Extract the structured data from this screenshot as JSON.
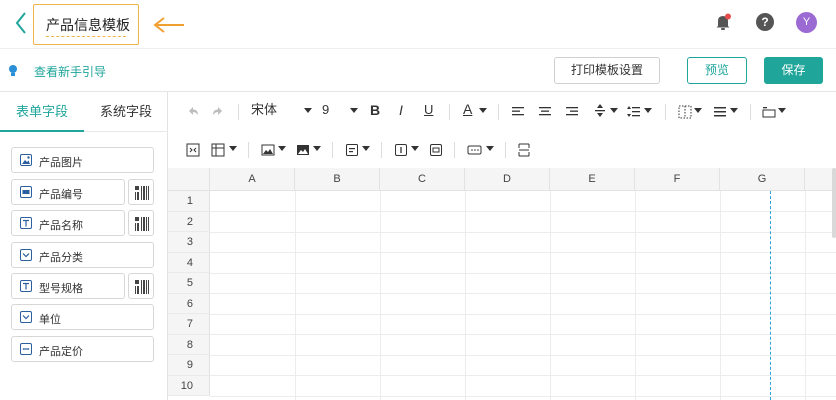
{
  "header": {
    "template_title": "产品信息模板",
    "avatar_letter": "Y",
    "help_symbol": "?",
    "icons": [
      "chevron-left-icon",
      "arrow-left-icon",
      "bell-icon",
      "help-icon"
    ],
    "colors": {
      "accent": "#1fa59a",
      "highlight": "#f0b44c",
      "notification_dot": "#e84d4d",
      "avatar": "#9b6ad2"
    }
  },
  "actionbar": {
    "guide_link": "查看新手引导",
    "print_settings": "打印模板设置",
    "preview": "预览",
    "save": "保存"
  },
  "sidebar": {
    "tabs": [
      "表单字段",
      "系统字段"
    ],
    "fields": [
      {
        "label": "产品图片",
        "icon": "image-icon",
        "barcode": false
      },
      {
        "label": "产品编号",
        "icon": "number-icon",
        "barcode": true
      },
      {
        "label": "产品名称",
        "icon": "text-icon",
        "barcode": true
      },
      {
        "label": "产品分类",
        "icon": "dropdown-icon",
        "barcode": false
      },
      {
        "label": "型号规格",
        "icon": "text-icon",
        "barcode": true
      },
      {
        "label": "单位",
        "icon": "dropdown-icon",
        "barcode": false
      },
      {
        "label": "产品定价",
        "icon": "amount-icon",
        "barcode": false
      }
    ]
  },
  "toolbar": {
    "font_family": "宋体",
    "font_size": "9",
    "bold": "B",
    "italic": "I",
    "underline": "U",
    "font_color": "A"
  },
  "sheet": {
    "columns": [
      "A",
      "B",
      "C",
      "D",
      "E",
      "F",
      "G"
    ],
    "rows": [
      "1",
      "2",
      "3",
      "4",
      "5",
      "6",
      "7",
      "8",
      "9",
      "10"
    ]
  }
}
